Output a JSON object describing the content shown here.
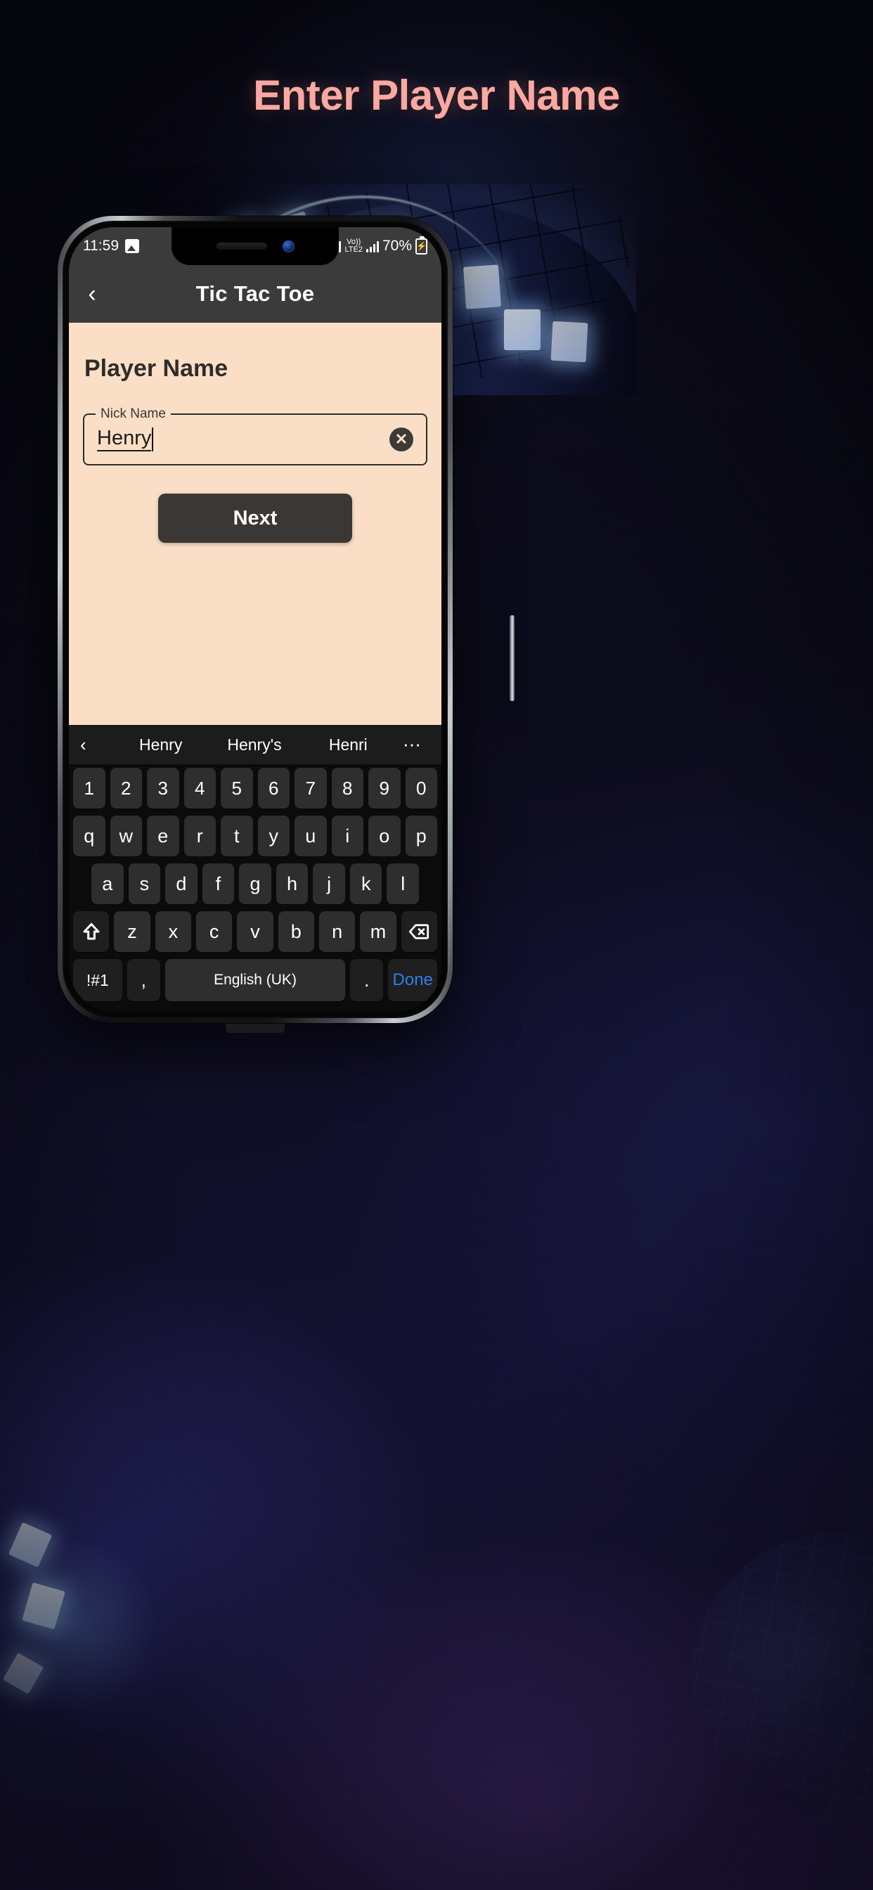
{
  "headline": "Enter Player Name",
  "theme": {
    "accent_pink": "#fba8a2",
    "panel_peach": "#fadfc6",
    "appbar_dark": "#3b3b3b",
    "button_dark": "#3b3734",
    "done_blue": "#2f7ef0",
    "keyboard_bg": "#0b0b0b",
    "key_bg": "#2e2e2e"
  },
  "status_bar": {
    "time": "11:59",
    "left_icons": [
      "image-icon"
    ],
    "network_label": "Vo))",
    "network_type": "LTE2",
    "battery_percent": "70%",
    "battery_icon": "battery-charging-icon"
  },
  "app_bar": {
    "back_icon": "chevron-left-icon",
    "title": "Tic Tac Toe"
  },
  "content": {
    "heading": "Player Name",
    "field": {
      "label": "Nick Name",
      "value": "Henry",
      "placeholder": "Nick Name",
      "clear_icon": "clear-circle-icon"
    },
    "next_button": "Next"
  },
  "keyboard": {
    "suggestions": {
      "back_icon": "chevron-left-icon",
      "items": [
        "Henry",
        "Henry's",
        "Henri"
      ],
      "more_icon": "overflow-dots-icon"
    },
    "rows": {
      "numbers": [
        "1",
        "2",
        "3",
        "4",
        "5",
        "6",
        "7",
        "8",
        "9",
        "0"
      ],
      "row1": [
        "q",
        "w",
        "e",
        "r",
        "t",
        "y",
        "u",
        "i",
        "o",
        "p"
      ],
      "row2": [
        "a",
        "s",
        "d",
        "f",
        "g",
        "h",
        "j",
        "k",
        "l"
      ],
      "row3": [
        "z",
        "x",
        "c",
        "v",
        "b",
        "n",
        "m"
      ],
      "shift_icon": "shift-arrow-icon",
      "backspace_icon": "backspace-icon"
    },
    "bottom_row": {
      "symbols": "!#1",
      "comma": ",",
      "space_label": "English (UK)",
      "period": ".",
      "done": "Done"
    }
  }
}
